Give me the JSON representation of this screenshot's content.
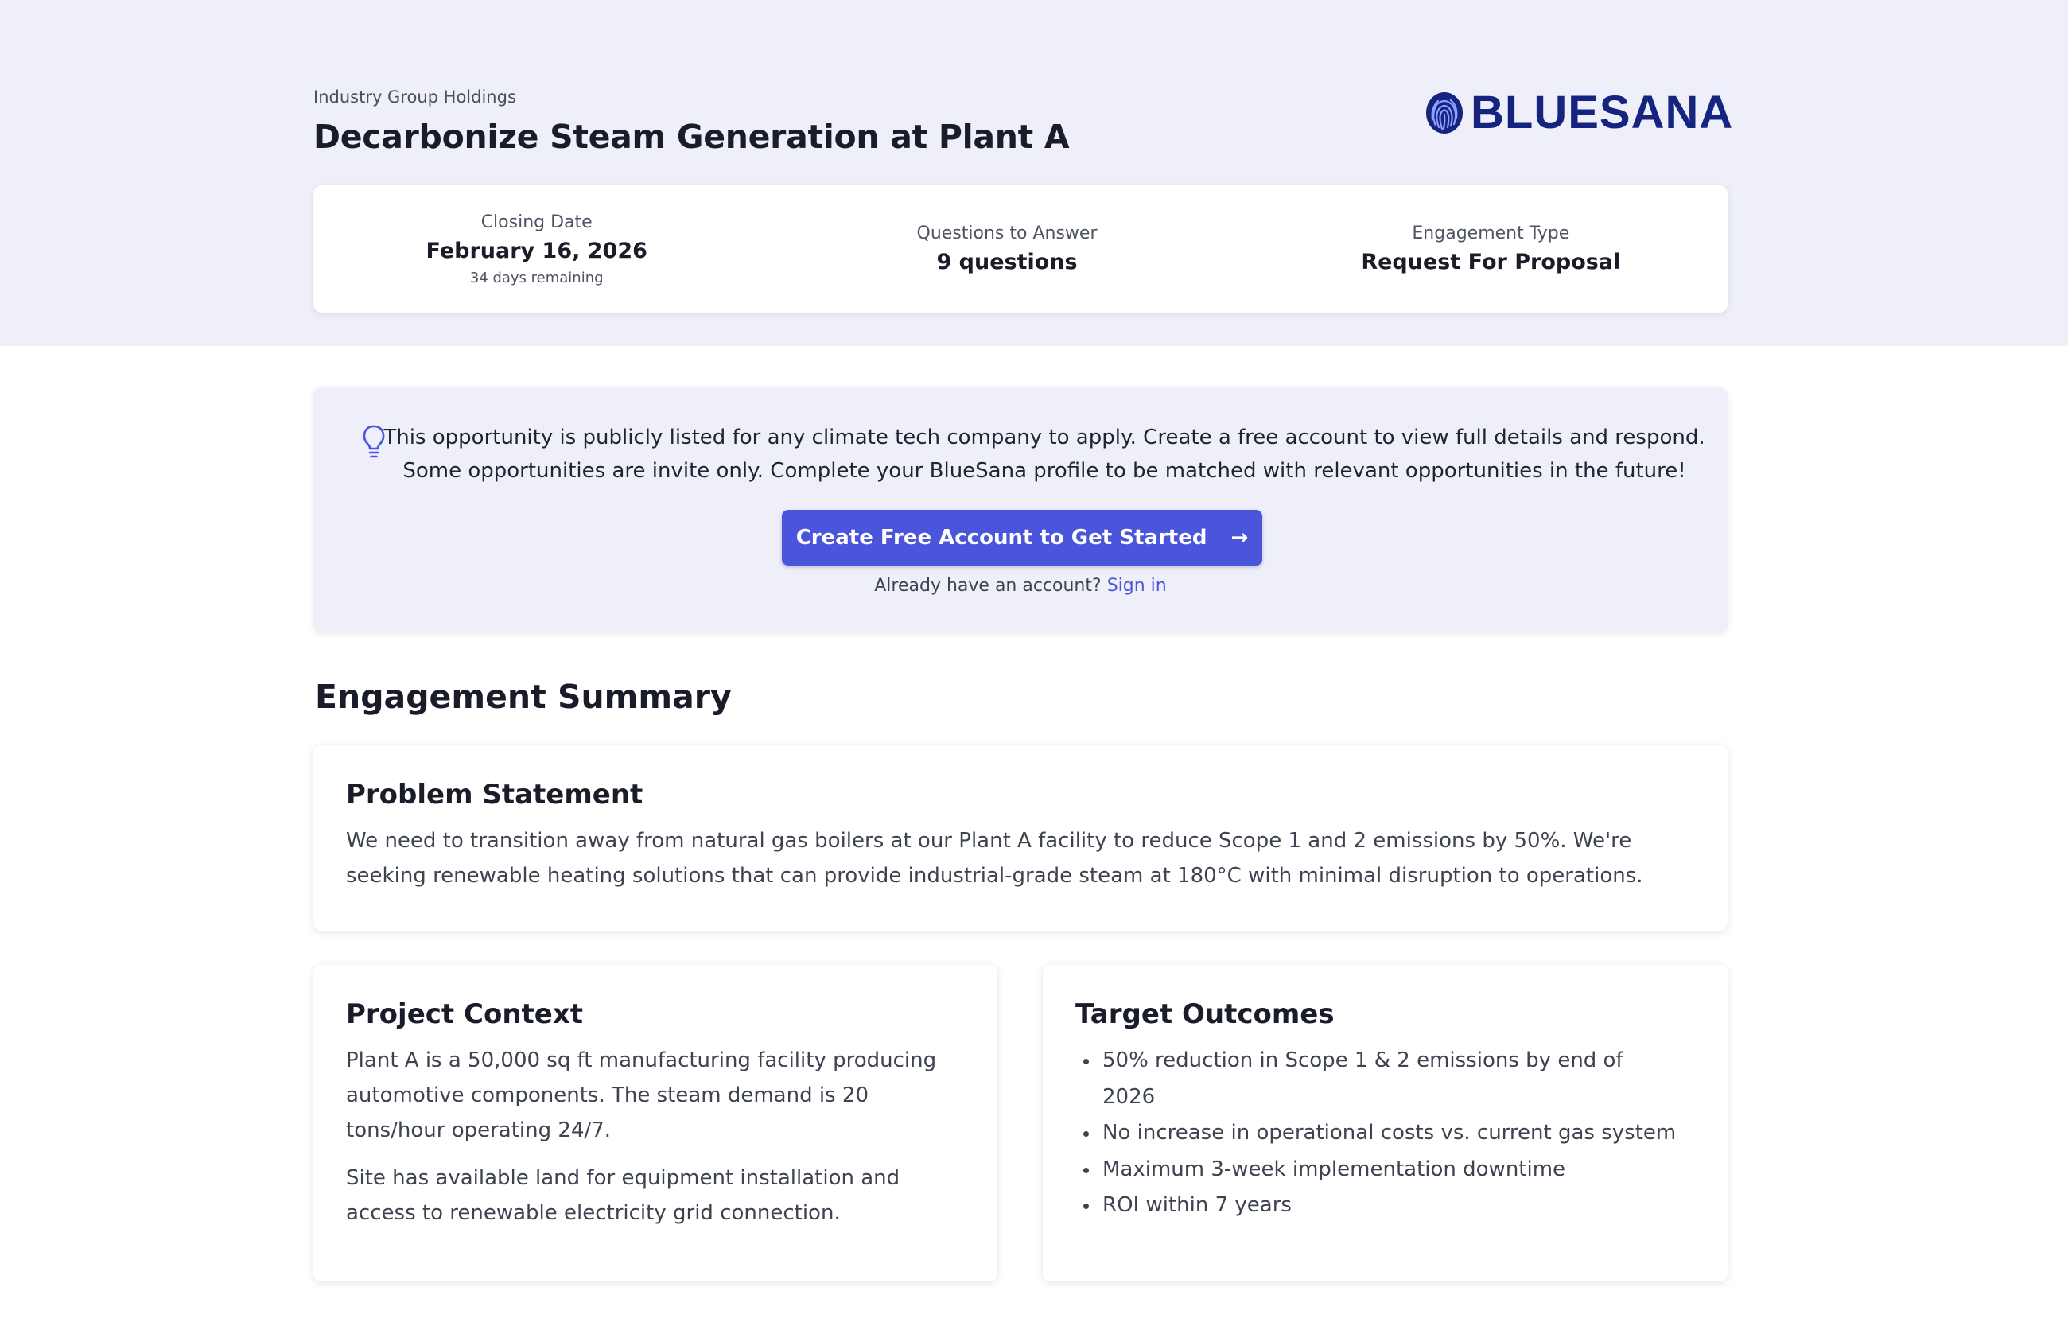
{
  "header": {
    "organization": "Industry Group Holdings",
    "title": "Decarbonize Steam Generation at Plant A",
    "logo_text": "BLUESANA",
    "logo_icon": "fingerprint-icon",
    "brand_color": "#15257f"
  },
  "stats": {
    "closing_date": {
      "label": "Closing Date",
      "value": "February 16, 2026",
      "note": "34 days remaining"
    },
    "questions": {
      "label": "Questions to Answer",
      "value": "9 questions"
    },
    "engagement_type": {
      "label": "Engagement Type",
      "value": "Request For Proposal"
    }
  },
  "notice": {
    "icon": "lightbulb-icon",
    "line1": "This opportunity is publicly listed for any climate tech company to apply. Create a free account to view full details and respond.",
    "line2": "Some opportunities are invite only. Complete your BlueSana profile to be matched with relevant opportunities in the future!",
    "cta_label": "Create Free Account to Get Started",
    "cta_arrow": "→",
    "signin_prompt": "Already have an account?",
    "signin_link": "Sign in",
    "accent_color": "#4a55dc"
  },
  "summary": {
    "title": "Engagement Summary",
    "problem": {
      "title": "Problem Statement",
      "text": "We need to transition away from natural gas boilers at our Plant A facility to reduce Scope 1 and 2 emissions by 50%. We're seeking renewable heating solutions that can provide industrial-grade steam at 180°C with minimal disruption to operations."
    },
    "context": {
      "title": "Project Context",
      "paragraphs": [
        "Plant A is a 50,000 sq ft manufacturing facility producing automotive components. The steam demand is 20 tons/hour operating 24/7.",
        "Site has available land for equipment installation and access to renewable electricity grid connection."
      ]
    },
    "outcomes": {
      "title": "Target Outcomes",
      "items": [
        "50% reduction in Scope 1 & 2 emissions by end of 2026",
        "No increase in operational costs vs. current gas system",
        "Maximum 3-week implementation downtime",
        "ROI within 7 years"
      ]
    }
  }
}
